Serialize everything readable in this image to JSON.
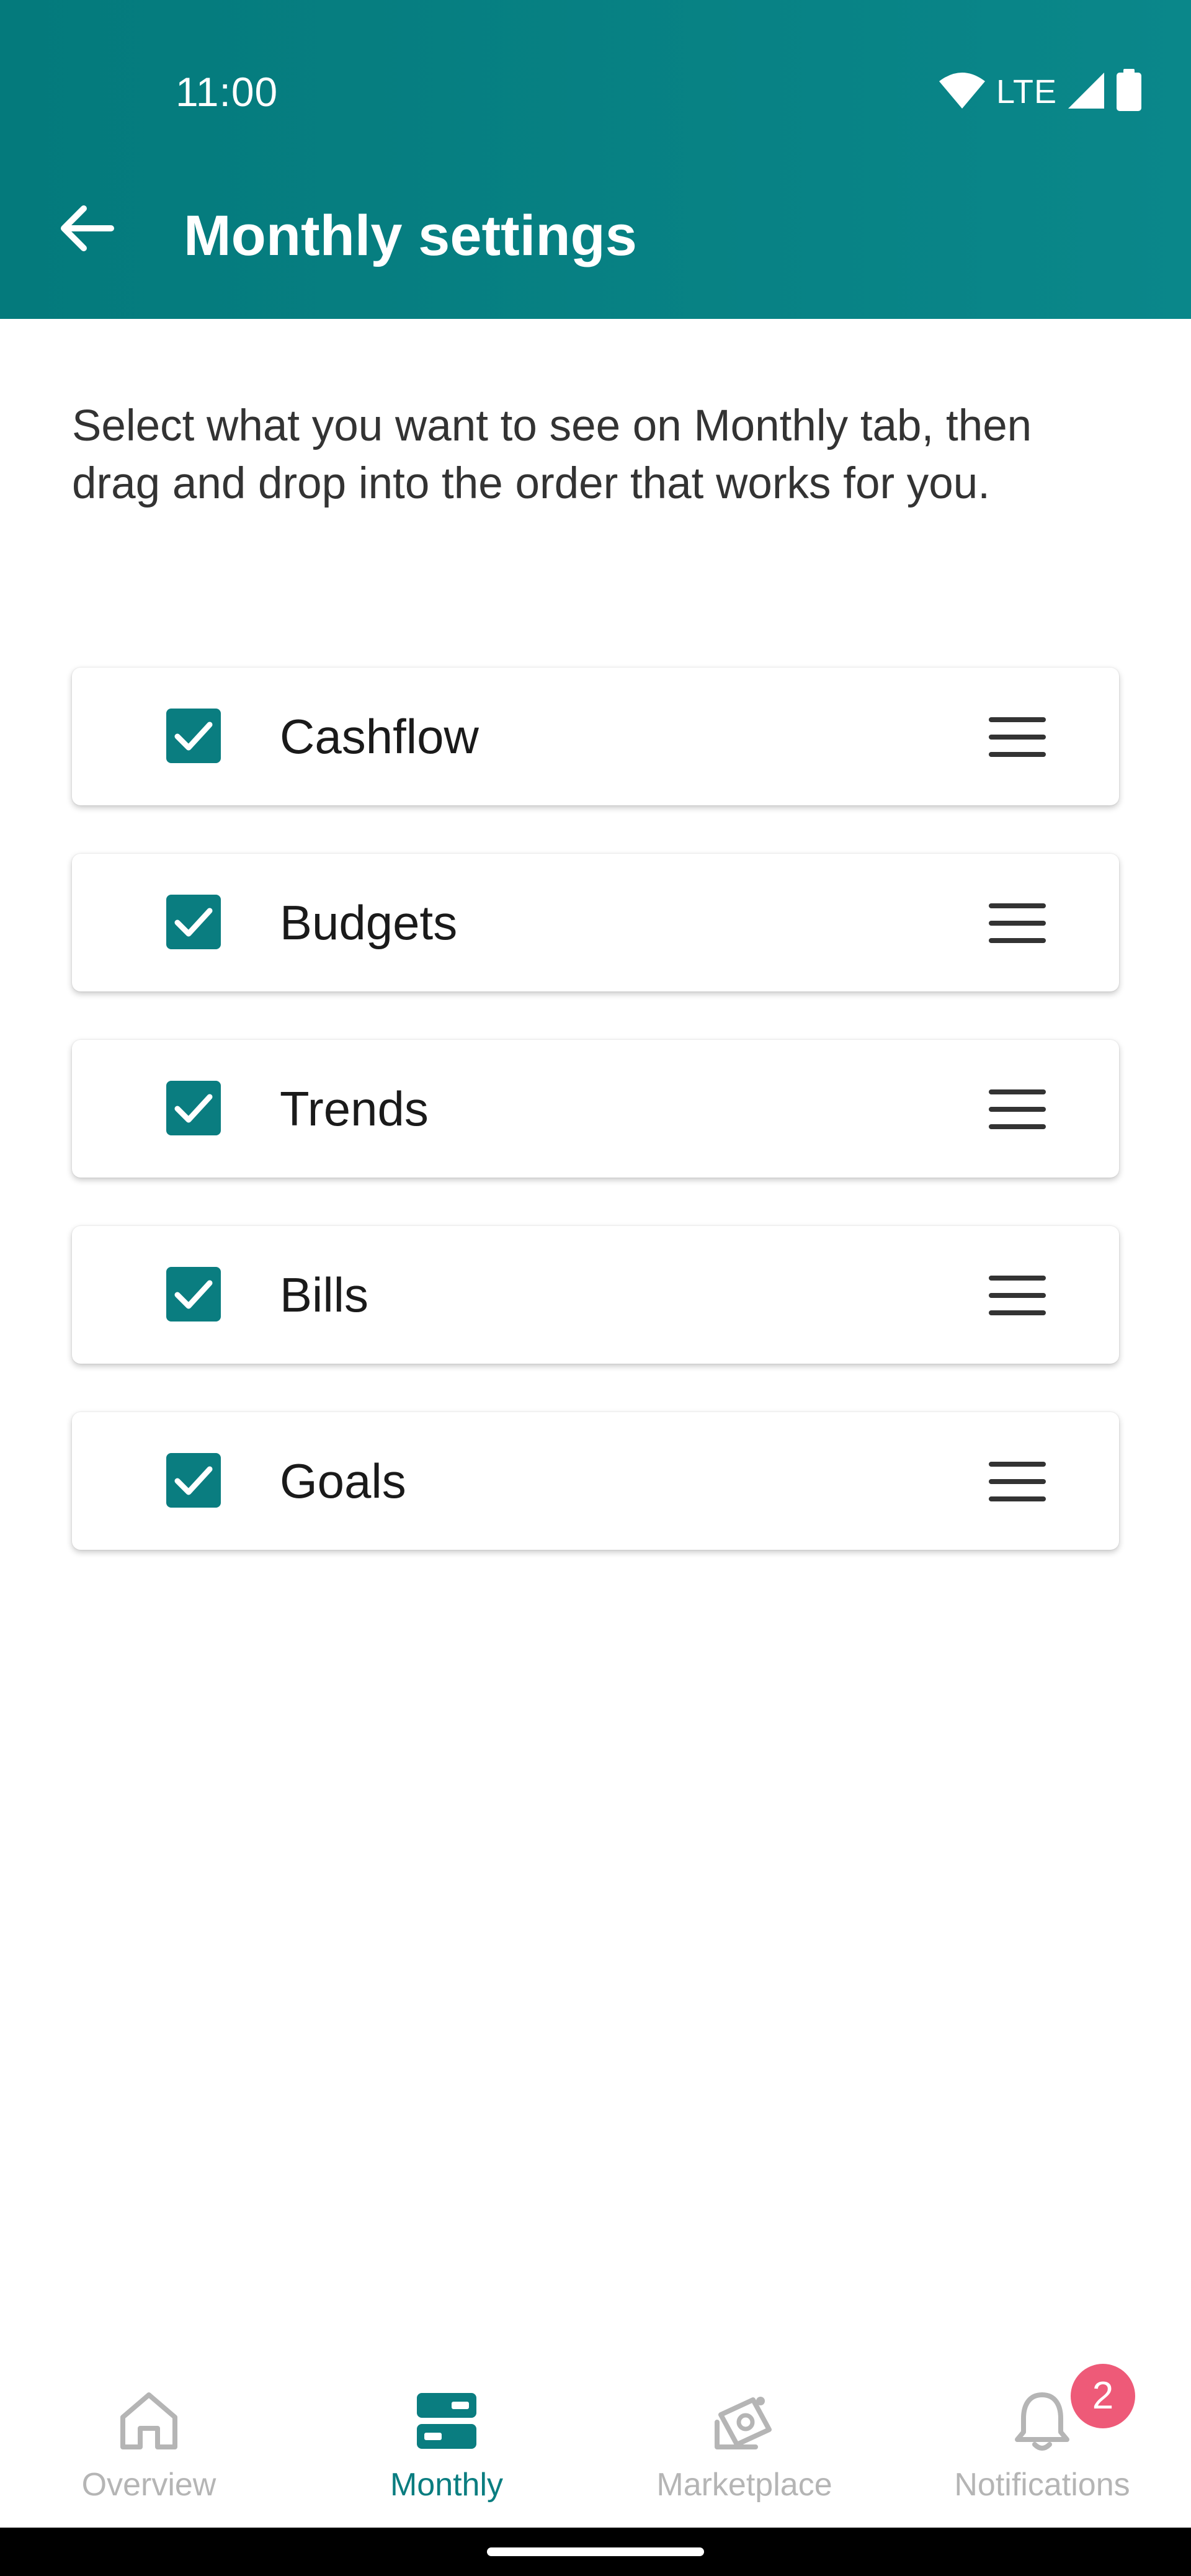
{
  "status_bar": {
    "time": "11:00",
    "network": "LTE",
    "icons": [
      "wifi-icon",
      "signal-icon",
      "battery-icon"
    ]
  },
  "header": {
    "title": "Monthly settings",
    "back_icon": "arrow-left-icon"
  },
  "description": "Select what you want to see on Monthly tab, then drag and drop into the order that works for you.",
  "items": [
    {
      "label": "Cashflow",
      "checked": true
    },
    {
      "label": "Budgets",
      "checked": true
    },
    {
      "label": "Trends",
      "checked": true
    },
    {
      "label": "Bills",
      "checked": true
    },
    {
      "label": "Goals",
      "checked": true
    }
  ],
  "bottom_nav": {
    "items": [
      {
        "label": "Overview",
        "icon": "home-icon",
        "active": false
      },
      {
        "label": "Monthly",
        "icon": "monthly-icon",
        "active": true
      },
      {
        "label": "Marketplace",
        "icon": "marketplace-icon",
        "active": false
      },
      {
        "label": "Notifications",
        "icon": "bell-icon",
        "active": false,
        "badge": "2"
      }
    ]
  },
  "colors": {
    "primary": "#0a7d80",
    "badge": "#ee5a78",
    "inactive": "#b5b5b5"
  }
}
